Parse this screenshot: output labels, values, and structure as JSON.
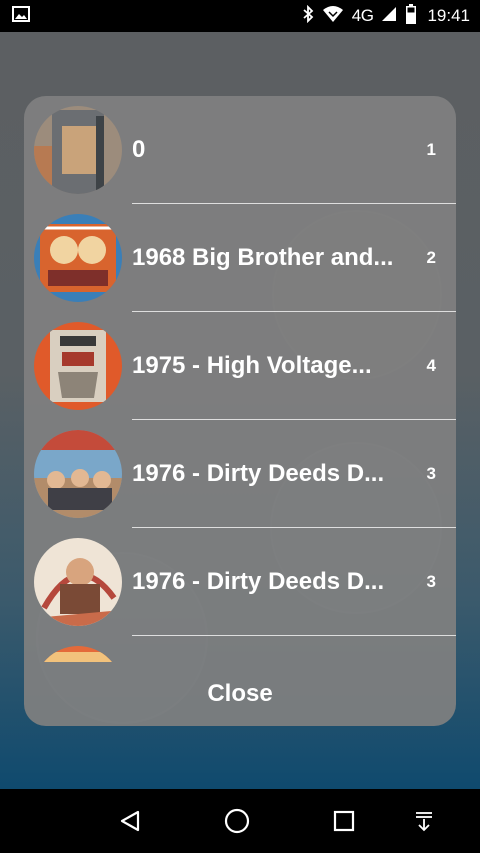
{
  "status_bar": {
    "network": "4G",
    "time": "19:41"
  },
  "albums": [
    {
      "title": "0",
      "count": "1"
    },
    {
      "title": "1968 Big Brother and...",
      "count": "2"
    },
    {
      "title": "1975 - High Voltage...",
      "count": "4"
    },
    {
      "title": "1976 - Dirty Deeds D...",
      "count": "3"
    },
    {
      "title": "1976 - Dirty Deeds D...",
      "count": "3"
    }
  ],
  "dialog": {
    "close_label": "Close"
  },
  "icons": {
    "status": [
      "image-notification-icon",
      "bluetooth-icon",
      "wifi-icon",
      "signal-icon",
      "battery-icon"
    ],
    "nav": [
      "back-icon",
      "home-icon",
      "recents-icon",
      "notification-shade-icon"
    ]
  },
  "colors": {
    "dialog_bg": "#808080",
    "text": "#ffffff",
    "status_bar": "#000000"
  }
}
